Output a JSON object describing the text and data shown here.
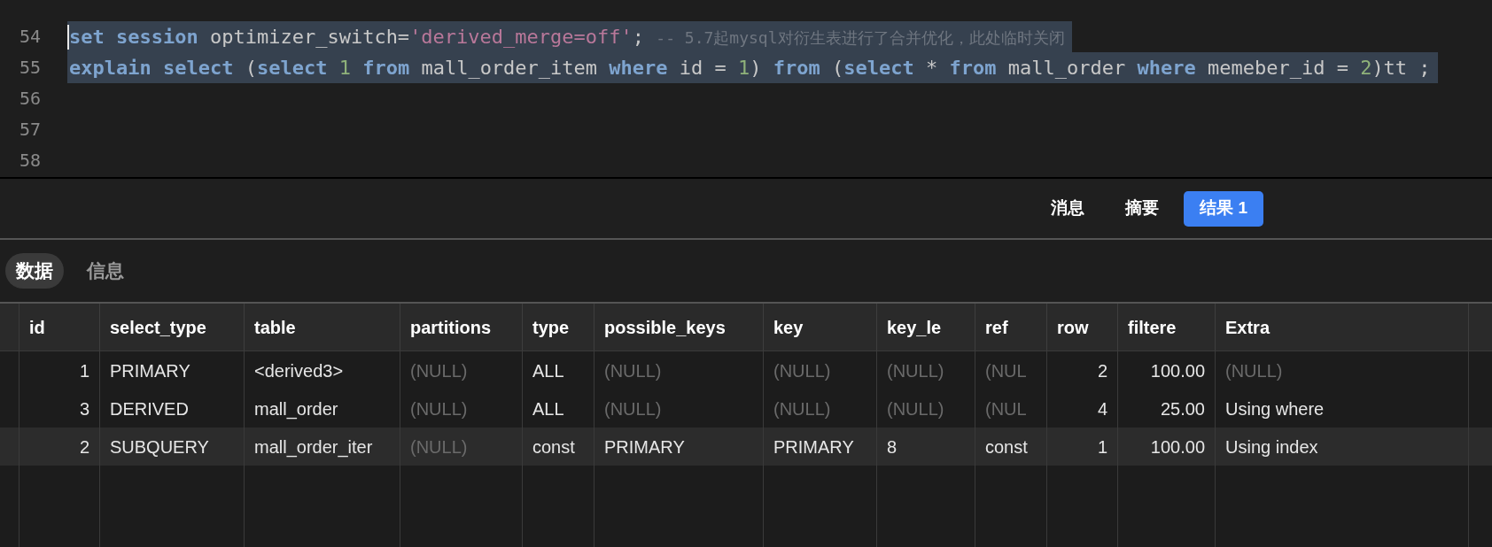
{
  "editor": {
    "lines": [
      {
        "number": "54",
        "selected": true,
        "cursor": true,
        "tokens": [
          {
            "kind": "keyword",
            "text": "set session"
          },
          {
            "kind": "plain",
            "text": " optimizer_switch="
          },
          {
            "kind": "string",
            "text": "'derived_merge=off'"
          },
          {
            "kind": "plain",
            "text": "; "
          },
          {
            "kind": "comment",
            "text": "-- 5.7起mysql对衍生表进行了合并优化，此处临时关闭"
          }
        ]
      },
      {
        "number": "55",
        "selected": true,
        "cursor": false,
        "tokens": [
          {
            "kind": "keyword",
            "text": "explain select"
          },
          {
            "kind": "plain",
            "text": " ("
          },
          {
            "kind": "keyword",
            "text": "select"
          },
          {
            "kind": "number",
            "text": " 1"
          },
          {
            "kind": "keyword",
            "text": " from"
          },
          {
            "kind": "plain",
            "text": " mall_order_item "
          },
          {
            "kind": "keyword",
            "text": "where"
          },
          {
            "kind": "plain",
            "text": " id = "
          },
          {
            "kind": "number",
            "text": "1"
          },
          {
            "kind": "plain",
            "text": ") "
          },
          {
            "kind": "keyword",
            "text": "from"
          },
          {
            "kind": "plain",
            "text": " ("
          },
          {
            "kind": "keyword",
            "text": "select"
          },
          {
            "kind": "plain",
            "text": " * "
          },
          {
            "kind": "keyword",
            "text": "from"
          },
          {
            "kind": "plain",
            "text": " mall_order "
          },
          {
            "kind": "keyword",
            "text": "where"
          },
          {
            "kind": "plain",
            "text": " memeber_id = "
          },
          {
            "kind": "number",
            "text": "2"
          },
          {
            "kind": "plain",
            "text": ")tt ;"
          }
        ]
      },
      {
        "number": "56",
        "selected": false,
        "cursor": false
      },
      {
        "number": "57",
        "selected": false,
        "cursor": false
      },
      {
        "number": "58",
        "selected": false,
        "cursor": false
      }
    ]
  },
  "result_tabs": [
    {
      "label": "消息",
      "selected": false
    },
    {
      "label": "摘要",
      "selected": false
    },
    {
      "label": "结果 1",
      "selected": true
    }
  ],
  "view_tabs": [
    {
      "label": "数据",
      "selected": true
    },
    {
      "label": "信息",
      "selected": false
    }
  ],
  "table": {
    "columns": [
      {
        "label": "id",
        "kind": "numeric"
      },
      {
        "label": "select_type",
        "kind": "text"
      },
      {
        "label": "table",
        "kind": "text"
      },
      {
        "label": "partitions",
        "kind": "text"
      },
      {
        "label": "type",
        "kind": "text"
      },
      {
        "label": "possible_keys",
        "kind": "text"
      },
      {
        "label": "key",
        "kind": "text"
      },
      {
        "label": "key_le",
        "kind": "text"
      },
      {
        "label": "ref",
        "kind": "text"
      },
      {
        "label": "row",
        "kind": "numeric"
      },
      {
        "label": "filtere",
        "kind": "numeric"
      },
      {
        "label": "Extra",
        "kind": "text"
      }
    ],
    "rows": [
      {
        "selected": false,
        "cells": [
          {
            "kind": "value",
            "text": "1"
          },
          {
            "kind": "value",
            "text": "PRIMARY"
          },
          {
            "kind": "value",
            "text": "<derived3>"
          },
          {
            "kind": "null",
            "text": "(NULL)"
          },
          {
            "kind": "value",
            "text": "ALL"
          },
          {
            "kind": "null",
            "text": "(NULL)"
          },
          {
            "kind": "null",
            "text": "(NULL)"
          },
          {
            "kind": "null",
            "text": "(NULL)"
          },
          {
            "kind": "null",
            "text": "(NUL"
          },
          {
            "kind": "value",
            "text": "2"
          },
          {
            "kind": "value",
            "text": "100.00"
          },
          {
            "kind": "null",
            "text": "(NULL)"
          }
        ]
      },
      {
        "selected": false,
        "cells": [
          {
            "kind": "value",
            "text": "3"
          },
          {
            "kind": "value",
            "text": "DERIVED"
          },
          {
            "kind": "value",
            "text": "mall_order"
          },
          {
            "kind": "null",
            "text": "(NULL)"
          },
          {
            "kind": "value",
            "text": "ALL"
          },
          {
            "kind": "null",
            "text": "(NULL)"
          },
          {
            "kind": "null",
            "text": "(NULL)"
          },
          {
            "kind": "null",
            "text": "(NULL)"
          },
          {
            "kind": "null",
            "text": "(NUL"
          },
          {
            "kind": "value",
            "text": "4"
          },
          {
            "kind": "value",
            "text": "25.00"
          },
          {
            "kind": "value",
            "text": "Using where"
          }
        ]
      },
      {
        "selected": true,
        "cells": [
          {
            "kind": "value",
            "text": "2"
          },
          {
            "kind": "value",
            "text": "SUBQUERY"
          },
          {
            "kind": "value",
            "text": "mall_order_iter"
          },
          {
            "kind": "null",
            "text": "(NULL)"
          },
          {
            "kind": "value",
            "text": "const"
          },
          {
            "kind": "value",
            "text": "PRIMARY"
          },
          {
            "kind": "value",
            "text": "PRIMARY"
          },
          {
            "kind": "value",
            "text": "8"
          },
          {
            "kind": "value",
            "text": "const"
          },
          {
            "kind": "value",
            "text": "1"
          },
          {
            "kind": "value",
            "text": "100.00"
          },
          {
            "kind": "value",
            "text": "Using index"
          }
        ]
      }
    ]
  }
}
